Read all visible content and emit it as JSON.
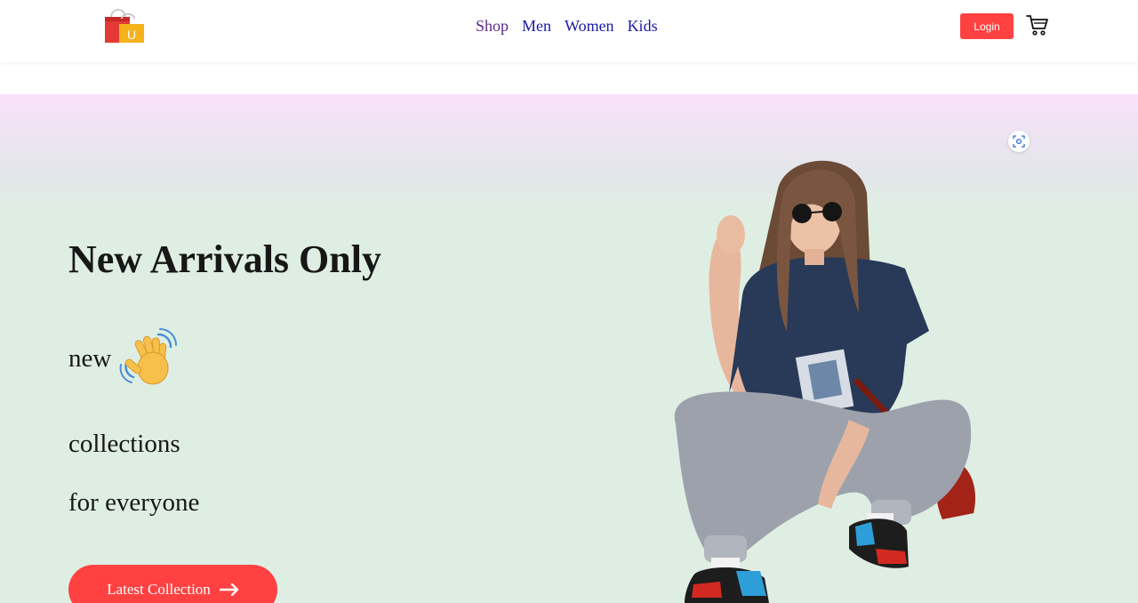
{
  "navbar": {
    "logo_letter": "U",
    "menu": [
      {
        "label": "Shop"
      },
      {
        "label": "Men"
      },
      {
        "label": "Women"
      },
      {
        "label": "Kids"
      }
    ],
    "login_label": "Login",
    "cart_icon": "cart-icon"
  },
  "hero": {
    "title": "New Arrivals Only",
    "line1": "new",
    "line2": "collections",
    "line3": "for everyone",
    "wave_icon": "waving-hand-icon",
    "cta_label": "Latest Collection",
    "cta_icon": "arrow-right-icon",
    "lens_icon": "visual-search-icon",
    "image_subject": "woman in sunglasses, navy t-shirt and grey joggers crouching"
  },
  "colors": {
    "accent": "#ff4141",
    "hero_top": "#f9e1fa",
    "hero_bottom": "#dfeee3",
    "text": "#171717"
  }
}
